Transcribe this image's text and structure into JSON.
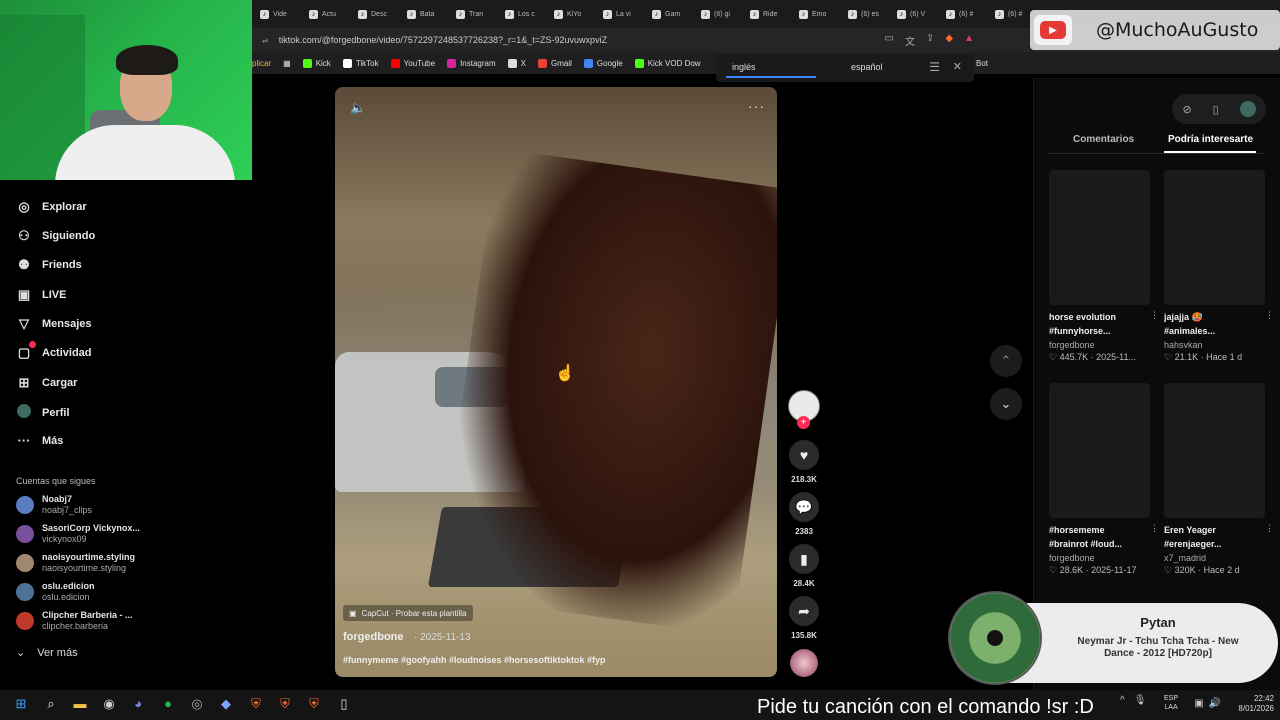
{
  "browser": {
    "tabs": [
      "Vide",
      "Actu",
      "Desc",
      "Bata",
      "Tran",
      "Los c",
      "KiYo",
      "La vi",
      "Gam",
      "(6) gi",
      "Ride",
      "Emo",
      "(6) es",
      "(6) V",
      "(6) #",
      "(6) #"
    ],
    "url": "tiktok.com/@forgedbone/video/7572297248537726238?_r=1&_t=ZS-92uvuwxpviZ",
    "bookmarks": [
      {
        "label": "Kick",
        "color": "#53fc18"
      },
      {
        "label": "TikTok",
        "color": "#ffffff"
      },
      {
        "label": "YouTube",
        "color": "#ff0000"
      },
      {
        "label": "Instagram",
        "color": "#d6249f"
      },
      {
        "label": "X",
        "color": "#dddddd"
      },
      {
        "label": "Gmail",
        "color": "#ea4335"
      },
      {
        "label": "Google",
        "color": "#4285f4"
      },
      {
        "label": "Kick VOD Dow",
        "color": "#53fc18"
      }
    ],
    "bookmark_prefix": "plicar",
    "bookmark_suffix": "Bot",
    "translate": {
      "lang_from": "inglés",
      "lang_to": "español"
    }
  },
  "sidebar": {
    "items": [
      {
        "label": "Explorar",
        "icon": "compass-icon"
      },
      {
        "label": "Siguiendo",
        "icon": "following-icon"
      },
      {
        "label": "Friends",
        "icon": "friends-icon"
      },
      {
        "label": "LIVE",
        "icon": "live-icon"
      },
      {
        "label": "Mensajes",
        "icon": "messages-icon"
      },
      {
        "label": "Actividad",
        "icon": "activity-icon"
      },
      {
        "label": "Cargar",
        "icon": "upload-icon"
      },
      {
        "label": "Perfil",
        "icon": "profile-avatar"
      },
      {
        "label": "Más",
        "icon": "more-icon"
      }
    ],
    "following_heading": "Cuentas que sigues",
    "accounts": [
      {
        "name": "Noabj7",
        "handle": "noabj7_clips",
        "color": "#5a7cc0"
      },
      {
        "name": "SasoriCorp Vickynox...",
        "handle": "vickynox09",
        "color": "#7a4f9c"
      },
      {
        "name": "naoisyourtime.styling",
        "handle": "naoisyourtime.styling",
        "color": "#a08870"
      },
      {
        "name": "oslu.edicion",
        "handle": "oslu.edicion",
        "color": "#4d7394"
      },
      {
        "name": "Clipcher Barberia - ...",
        "handle": "clipcher.barberia",
        "color": "#c0392b"
      }
    ],
    "see_more": "Ver más"
  },
  "video": {
    "capcut_label": "CapCut · Probar esta plantilla",
    "author": "forgedbone",
    "date": "· 2025-11-13",
    "hashtags": "#funnymeme #goofyahh #loudnoises #horsesoftiktoktok  #fyp",
    "actions": {
      "likes": "218.3K",
      "comments": "2383",
      "saves": "28.4K",
      "shares": "135.8K"
    }
  },
  "right_panel": {
    "tabs": [
      "Comentarios",
      "Podría interesarte"
    ],
    "cards": [
      {
        "title": "horse evolution",
        "title2": "#funnyhorse...",
        "author": "forgedbone",
        "stats": "♡ 445.7K · 2025-11..."
      },
      {
        "title": "jajajja 🥵",
        "title2": "#animales...",
        "author": "hahsvkan",
        "stats": "♡ 21.1K · Hace 1 d"
      },
      {
        "title": "#horsememe",
        "title2": "#brainrot #loud...",
        "author": "forgedbone",
        "stats": "♡ 28.6K · 2025-11-17"
      },
      {
        "title": "Eren Yeager",
        "title2": "#erenjaeger...",
        "author": "x7_madrid",
        "stats": "♡ 320K · Hace 2 d"
      }
    ]
  },
  "overlays": {
    "yt_handle": "@MuchoAuGusto",
    "now_playing_requester": "Pytan",
    "now_playing_song": "Neymar Jr - Tchu Tcha Tcha - New Dance - 2012 [HD720p]",
    "song_request_text": "Pide tu canción con el comando !sr :D"
  },
  "taskbar": {
    "lang": "ESP",
    "lang2": "LAA",
    "time": "22:42",
    "date": "8/01/2026"
  }
}
